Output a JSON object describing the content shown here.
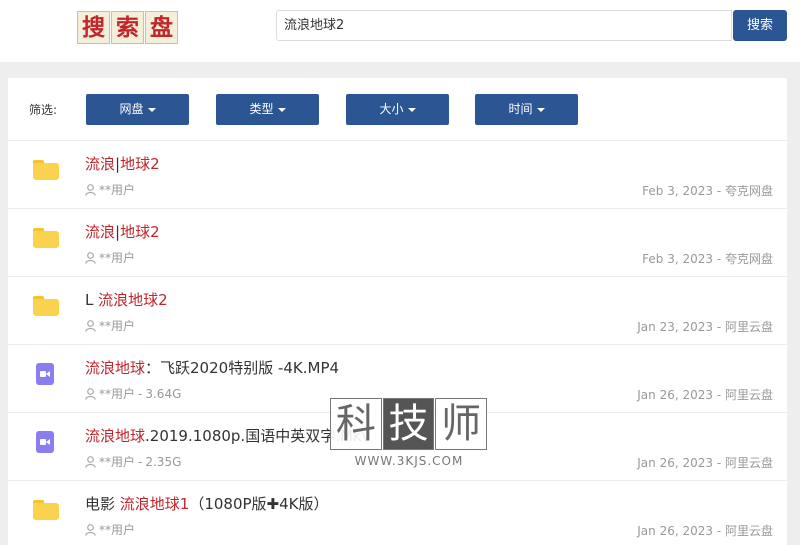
{
  "header": {
    "logo_chars": [
      "搜",
      "索",
      "盘"
    ],
    "search_value": "流浪地球2",
    "search_button": "搜索"
  },
  "filters": {
    "label": "筛选:",
    "buttons": [
      "网盘",
      "类型",
      "大小",
      "时间"
    ]
  },
  "results": [
    {
      "icon": "folder-icon",
      "pre": "",
      "hl1": "流浪",
      "mid": "|",
      "hl2": "地球2",
      "post": "",
      "user": "**用户",
      "size": "",
      "date": "Feb 3, 2023",
      "source": "夸克网盘"
    },
    {
      "icon": "folder-icon",
      "pre": "",
      "hl1": "流浪",
      "mid": "|",
      "hl2": "地球2",
      "post": "",
      "user": "**用户",
      "size": "",
      "date": "Feb 3, 2023",
      "source": "夸克网盘"
    },
    {
      "icon": "folder-icon",
      "pre": "L ",
      "hl1": "流浪地球2",
      "mid": "",
      "hl2": "",
      "post": "",
      "user": "**用户",
      "size": "",
      "date": "Jan 23, 2023",
      "source": "阿里云盘"
    },
    {
      "icon": "video-icon",
      "pre": "",
      "hl1": "流浪地球",
      "mid": "：飞跃2020特别版 -4K.MP4",
      "hl2": "",
      "post": "",
      "user": "**用户",
      "size": "3.64G",
      "date": "Jan 26, 2023",
      "source": "阿里云盘"
    },
    {
      "icon": "video-icon",
      "pre": "",
      "hl1": "流浪地球",
      "mid": ".2019.1080p.国语中英双字.Mkv",
      "hl2": "",
      "post": "",
      "user": "**用户",
      "size": "2.35G",
      "date": "Jan 26, 2023",
      "source": "阿里云盘"
    },
    {
      "icon": "folder-icon",
      "pre": "电影 ",
      "hl1": "流浪地球1",
      "mid": "（1080P版✚4K版）",
      "hl2": "",
      "post": "",
      "user": "**用户",
      "size": "",
      "date": "Jan 26, 2023",
      "source": "阿里云盘"
    }
  ],
  "watermark": {
    "chars": [
      "科",
      "技",
      "师"
    ],
    "url": "WWW.3KJS.COM"
  },
  "colors": {
    "brand": "#2c5594",
    "highlight": "#c0262c",
    "folder": "#fbd24e",
    "video": "#8a7df0"
  }
}
